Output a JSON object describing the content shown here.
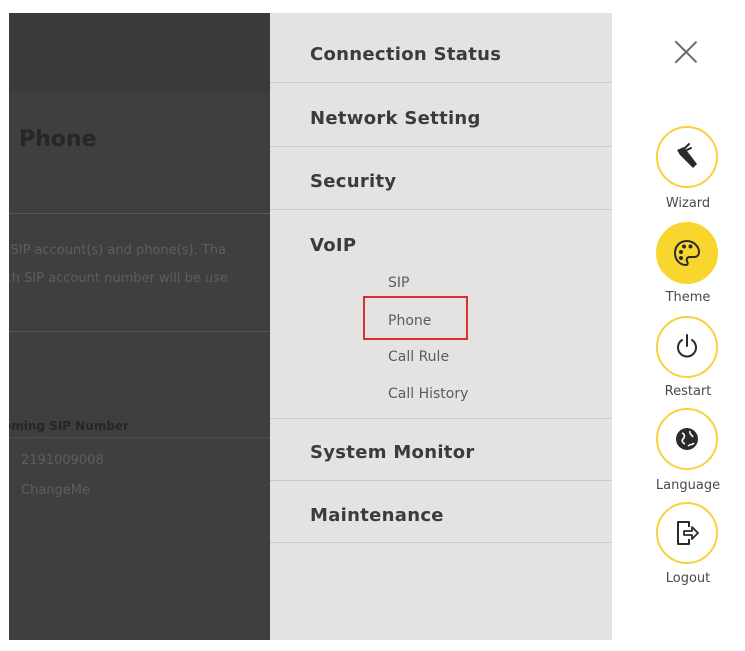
{
  "background_page": {
    "title": "Phone",
    "description_lines": [
      "r SIP account(s) and phone(s). Tha",
      "ich SIP account number will be use"
    ],
    "table_header": "oming SIP Number",
    "rows": [
      "2191009008",
      "ChangeMe"
    ]
  },
  "menu": {
    "items": [
      {
        "label": "Connection Status"
      },
      {
        "label": "Network Setting"
      },
      {
        "label": "Security"
      },
      {
        "label": "VoIP"
      },
      {
        "label": "System Monitor"
      },
      {
        "label": "Maintenance"
      }
    ],
    "voip_submenu": [
      "SIP",
      "Phone",
      "Call Rule",
      "Call History"
    ],
    "highlighted_submenu": "Phone"
  },
  "side_actions": [
    {
      "label": "Wizard",
      "icon": "wizard-wand-icon"
    },
    {
      "label": "Theme",
      "icon": "theme-palette-icon",
      "active": true
    },
    {
      "label": "Restart",
      "icon": "power-icon"
    },
    {
      "label": "Language",
      "icon": "globe-icon"
    },
    {
      "label": "Logout",
      "icon": "logout-icon"
    }
  ],
  "colors": {
    "accent": "#f9d62e",
    "highlight_box": "#e02e2e",
    "menu_bg": "#e3e3e3",
    "overlay_bg": "#3f3f3f"
  }
}
